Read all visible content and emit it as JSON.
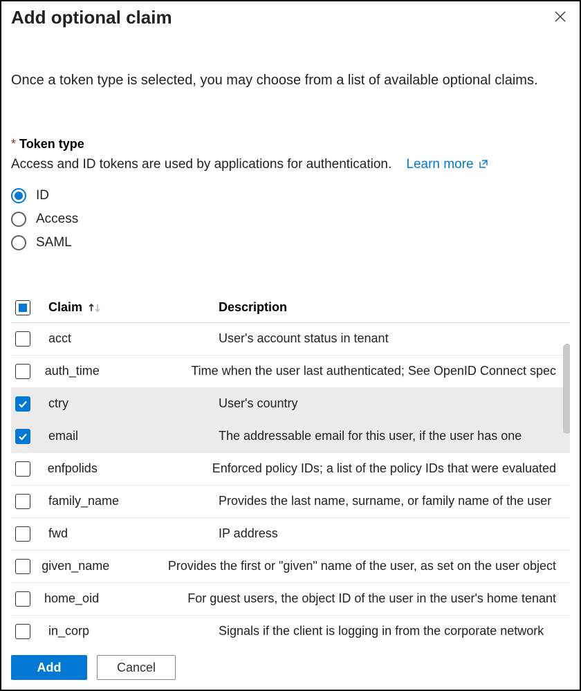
{
  "title": "Add optional claim",
  "intro": "Once a token type is selected, you may choose from a list of available optional claims.",
  "token_type": {
    "required_mark": "*",
    "label": "Token type",
    "helper": "Access and ID tokens are used by applications for authentication.",
    "learn_more": "Learn more",
    "options": [
      {
        "value": "ID",
        "selected": true
      },
      {
        "value": "Access",
        "selected": false
      },
      {
        "value": "SAML",
        "selected": false
      }
    ]
  },
  "table": {
    "headers": {
      "claim": "Claim",
      "description": "Description"
    },
    "header_check_state": "partial",
    "sort": {
      "column": "claim",
      "direction": "asc"
    },
    "rows": [
      {
        "claim": "acct",
        "description": "User's account status in tenant",
        "checked": false
      },
      {
        "claim": "auth_time",
        "description": "Time when the user last authenticated; See OpenID Connect spec",
        "checked": false
      },
      {
        "claim": "ctry",
        "description": "User's country",
        "checked": true
      },
      {
        "claim": "email",
        "description": "The addressable email for this user, if the user has one",
        "checked": true
      },
      {
        "claim": "enfpolids",
        "description": "Enforced policy IDs; a list of the policy IDs that were evaluated",
        "checked": false
      },
      {
        "claim": "family_name",
        "description": "Provides the last name, surname, or family name of the user",
        "checked": false
      },
      {
        "claim": "fwd",
        "description": "IP address",
        "checked": false
      },
      {
        "claim": "given_name",
        "description": "Provides the first or \"given\" name of the user, as set on the user object",
        "checked": false
      },
      {
        "claim": "home_oid",
        "description": "For guest users, the object ID of the user in the user's home tenant",
        "checked": false
      },
      {
        "claim": "in_corp",
        "description": "Signals if the client is logging in from the corporate network",
        "checked": false
      }
    ]
  },
  "buttons": {
    "add": "Add",
    "cancel": "Cancel"
  }
}
